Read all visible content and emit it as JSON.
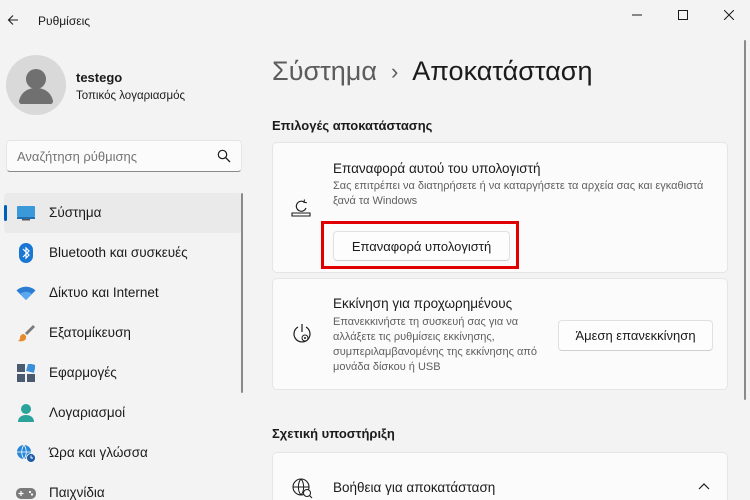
{
  "app": {
    "title": "Ρυθμίσεις"
  },
  "profile": {
    "name": "testego",
    "account_type": "Τοπικός λογαριασμός"
  },
  "search": {
    "placeholder": "Αναζήτηση ρύθμισης"
  },
  "sidebar": {
    "items": [
      {
        "label": "Σύστημα",
        "icon": "system-icon",
        "active": true
      },
      {
        "label": "Bluetooth και συσκευές",
        "icon": "bluetooth-icon"
      },
      {
        "label": "Δίκτυο και Internet",
        "icon": "wifi-icon"
      },
      {
        "label": "Εξατομίκευση",
        "icon": "brush-icon"
      },
      {
        "label": "Εφαρμογές",
        "icon": "apps-icon"
      },
      {
        "label": "Λογαριασμοί",
        "icon": "person-icon"
      },
      {
        "label": "Ώρα και γλώσσα",
        "icon": "globe-clock-icon"
      },
      {
        "label": "Παιχνίδια",
        "icon": "gamepad-icon"
      }
    ]
  },
  "breadcrumb": {
    "parent": "Σύστημα",
    "separator": "›",
    "current": "Αποκατάσταση"
  },
  "recovery": {
    "section_title": "Επιλογές αποκατάστασης",
    "reset": {
      "title": "Επαναφορά αυτού του υπολογιστή",
      "description": "Σας επιτρέπει να διατηρήσετε ή να καταργήσετε τα αρχεία σας και εγκαθιστά ξανά τα Windows",
      "button": "Επαναφορά υπολογιστή"
    },
    "advanced": {
      "title": "Εκκίνηση για προχωρημένους",
      "description": "Επανεκκινήστε τη συσκευή σας για να αλλάξετε τις ρυθμίσεις εκκίνησης, συμπεριλαμβανομένης της εκκίνησης από μονάδα δίσκου ή USB",
      "button": "Άμεση επανεκκίνηση"
    }
  },
  "support": {
    "section_title": "Σχετική υποστήριξη",
    "help": {
      "title": "Βοήθεια για αποκατάσταση"
    }
  },
  "colors": {
    "accent": "#005fb8",
    "highlight": "#e00000"
  }
}
